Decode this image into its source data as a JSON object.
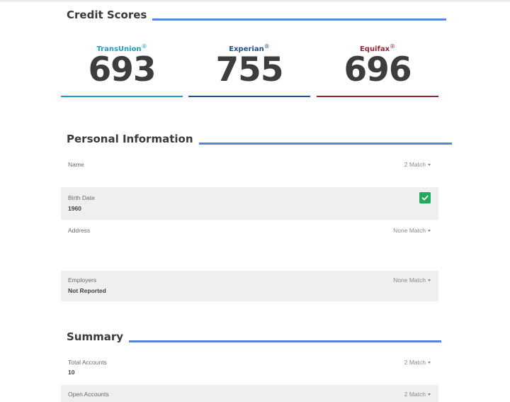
{
  "credit_scores": {
    "title": "Credit Scores",
    "bureaus": [
      {
        "name": "TransUnion",
        "mark": "®",
        "score": "693",
        "color": "#1a9fc4"
      },
      {
        "name": "Experian",
        "mark": "®",
        "score": "755",
        "color": "#1f4e8c"
      },
      {
        "name": "Equifax",
        "mark": "®",
        "score": "696",
        "color": "#9b2335"
      }
    ]
  },
  "personal_information": {
    "title": "Personal Information",
    "rows": [
      {
        "label": "Name",
        "value": "",
        "match": "2 Match"
      },
      {
        "label": "Birth Date",
        "value": "1960",
        "match": ""
      },
      {
        "label": "Address",
        "value": "",
        "match": "None Match"
      },
      {
        "label": "Employers",
        "value": "Not Reported",
        "match": "None Match"
      }
    ]
  },
  "summary": {
    "title": "Summary",
    "rows": [
      {
        "label": "Total Accounts",
        "value": "10",
        "match": "2 Match"
      },
      {
        "label": "Open Accounts",
        "value": "",
        "match": "2 Match"
      }
    ]
  },
  "icons": {
    "matched": "check-icon",
    "dropdown": "caret-down-icon"
  },
  "colors": {
    "section_rule": "#5588d4",
    "match_badge": "#22aa5d",
    "row_shade": "#efefef"
  }
}
